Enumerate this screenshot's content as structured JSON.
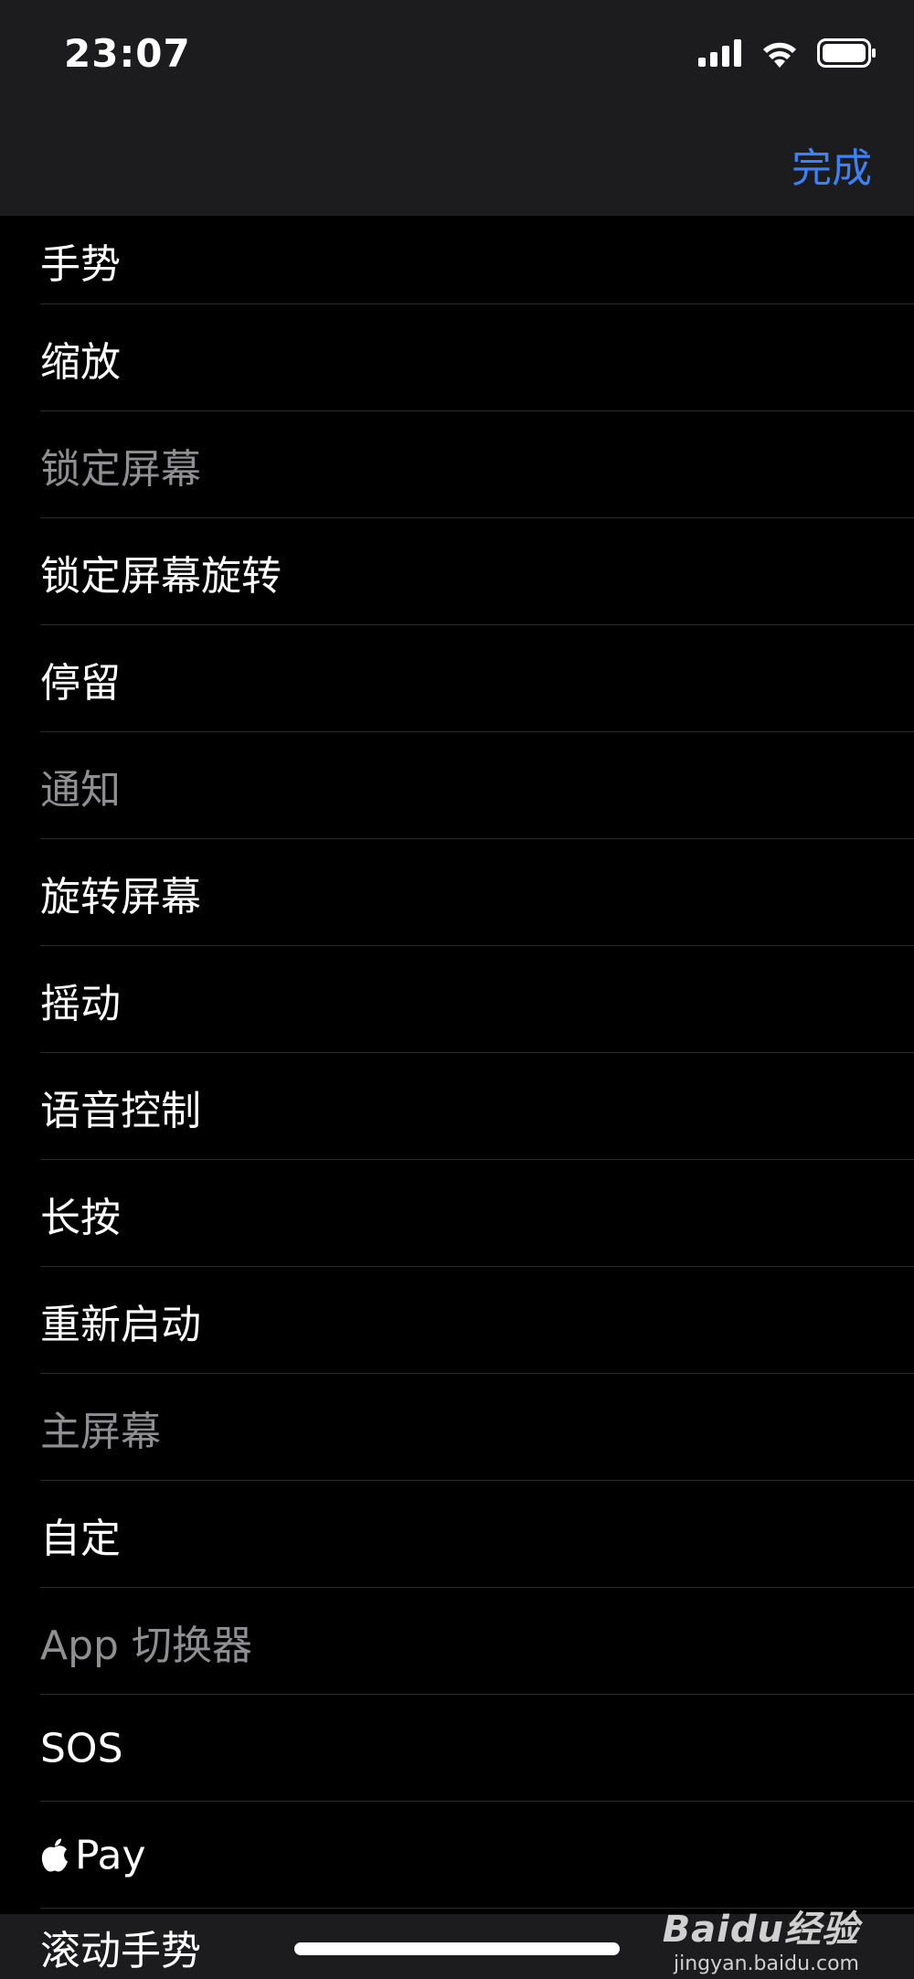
{
  "status_bar": {
    "time": "23:07"
  },
  "nav": {
    "done_label": "完成"
  },
  "items": [
    {
      "label": "手势",
      "enabled": true
    },
    {
      "label": "缩放",
      "enabled": true
    },
    {
      "label": "锁定屏幕",
      "enabled": false
    },
    {
      "label": "锁定屏幕旋转",
      "enabled": true
    },
    {
      "label": "停留",
      "enabled": true
    },
    {
      "label": "通知",
      "enabled": false
    },
    {
      "label": "旋转屏幕",
      "enabled": true
    },
    {
      "label": "摇动",
      "enabled": true
    },
    {
      "label": "语音控制",
      "enabled": true
    },
    {
      "label": "长按",
      "enabled": true
    },
    {
      "label": "重新启动",
      "enabled": true
    },
    {
      "label": "主屏幕",
      "enabled": false
    },
    {
      "label": "自定",
      "enabled": true
    },
    {
      "label": "App 切换器",
      "enabled": false
    },
    {
      "label": "SOS",
      "enabled": true
    },
    {
      "label": "Pay",
      "enabled": true,
      "icon": "apple-logo-icon"
    }
  ],
  "bottom_item": {
    "label": "滚动手势"
  },
  "watermark": {
    "brand": "Baidu经验",
    "url": "jingyan.baidu.com"
  },
  "colors": {
    "accent": "#3b82f6",
    "disabled_text": "#8e8e93",
    "background": "#000000",
    "bar": "#1c1c1e"
  }
}
